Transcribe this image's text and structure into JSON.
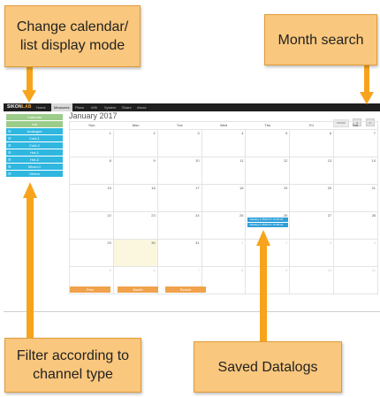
{
  "app": {
    "logo_main": "SIKON",
    "logo_accent": "LAB",
    "nav": [
      "Home",
      "Measures",
      "Plans",
      "Wifi",
      "System",
      "Share",
      "About"
    ],
    "month_title": "January 2017",
    "view_toggles": [
      "month",
      "<",
      ">"
    ],
    "sidebar": {
      "mode_buttons": [
        "Calendar",
        "List"
      ],
      "channels": [
        "Analogue",
        "Cold-1",
        "Cold-2",
        "Hot-1",
        "Hot-2",
        "Mixed-1",
        "Others"
      ]
    },
    "days_of_week": [
      "Sun",
      "Mon",
      "Tue",
      "Wed",
      "Thu",
      "Fri",
      "Sat"
    ],
    "weeks": [
      [
        "1",
        "2",
        "3",
        "4",
        "5",
        "6",
        "7"
      ],
      [
        "8",
        "9",
        "10",
        "11",
        "12",
        "13",
        "14"
      ],
      [
        "15",
        "16",
        "17",
        "18",
        "19",
        "20",
        "21"
      ],
      [
        "22",
        "23",
        "24",
        "25",
        "26",
        "27",
        "28"
      ],
      [
        "29",
        "30",
        "31",
        "1",
        "2",
        "3",
        "4"
      ],
      [
        "5",
        "6",
        "7",
        "8",
        "9",
        "10",
        "11"
      ]
    ],
    "events": [
      "Datalog 1 25/01/17 13:00:01",
      "Datalog 2 25/01/17 15:08:21"
    ],
    "bottom_buttons": [
      "Prev",
      "Month",
      "Search"
    ]
  },
  "callouts": {
    "top_left": "Change calendar/ list display mode",
    "top_right": "Month search",
    "bottom_left": "Filter according to channel type",
    "bottom_right": "Saved Datalogs"
  },
  "colors": {
    "callout_fill": "#f9c77d",
    "arrow": "#f7a41c",
    "channel_blue": "#2fb7e0",
    "mode_green": "#9ccc8a",
    "event_blue": "#2e9fd8",
    "button_orange": "#f0a24c"
  }
}
